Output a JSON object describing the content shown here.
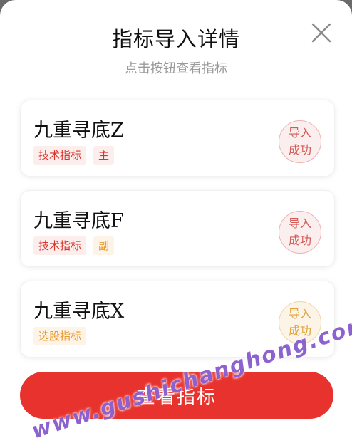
{
  "dialog": {
    "title": "指标导入详情",
    "subtitle": "点击按钮查看指标",
    "close_icon": "close-icon"
  },
  "cards": [
    {
      "title": "九重寻底Z",
      "tags": [
        {
          "label": "技术指标",
          "color": "#d9342b"
        },
        {
          "label": "主",
          "color": "#d9342b"
        }
      ],
      "status_line1": "导入",
      "status_line2": "成功",
      "status_color": "#d45a55"
    },
    {
      "title": "九重寻底F",
      "tags": [
        {
          "label": "技术指标",
          "color": "#d9342b"
        },
        {
          "label": "副",
          "color": "#e8982c"
        }
      ],
      "status_line1": "导入",
      "status_line2": "成功",
      "status_color": "#d45a55"
    },
    {
      "title": "九重寻底X",
      "tags": [
        {
          "label": "选股指标",
          "color": "#e8982c"
        }
      ],
      "status_line1": "导入",
      "status_line2": "成功",
      "status_color": "#e1a23a"
    }
  ],
  "primary_button": {
    "label": "查看指标",
    "color": "#e8322d"
  },
  "watermark": {
    "text": "www.gushichanghong.com"
  }
}
